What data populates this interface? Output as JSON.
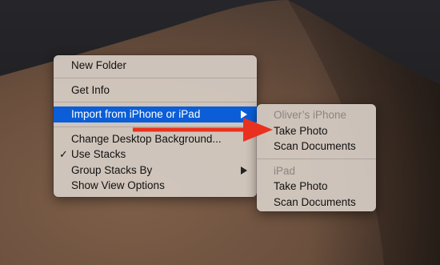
{
  "main_menu": {
    "items": [
      {
        "label": "New Folder"
      },
      {
        "label": "Get Info"
      },
      {
        "label": "Import from iPhone or iPad"
      },
      {
        "label": "Change Desktop Background..."
      },
      {
        "label": "Use Stacks",
        "checked": true
      },
      {
        "label": "Group Stacks By"
      },
      {
        "label": "Show View Options"
      }
    ]
  },
  "submenu": {
    "groups": [
      {
        "header": "Oliver’s iPhone",
        "items": [
          "Take Photo",
          "Scan Documents"
        ]
      },
      {
        "header": "iPad",
        "items": [
          "Take Photo",
          "Scan Documents"
        ]
      }
    ]
  },
  "colors": {
    "highlight": "#0b5ed7",
    "annotation_arrow": "#e8321f",
    "menu_background": "#d6ccc4"
  }
}
